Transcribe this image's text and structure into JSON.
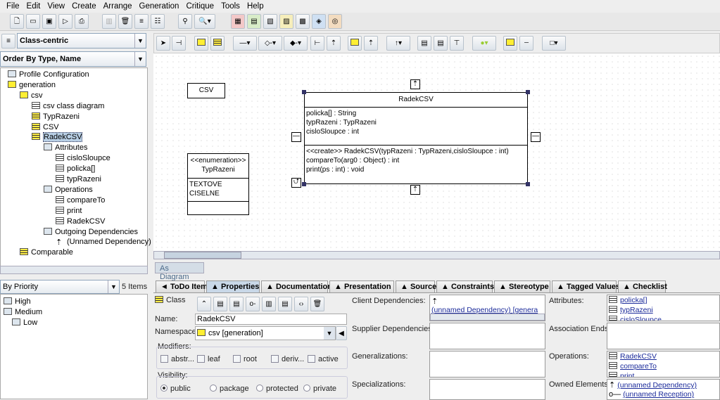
{
  "menu": [
    "File",
    "Edit",
    "View",
    "Create",
    "Arrange",
    "Generation",
    "Critique",
    "Tools",
    "Help"
  ],
  "explorer": {
    "perspective": "Class-centric",
    "order": "Order By Type, Name",
    "tree": [
      {
        "label": "Profile Configuration",
        "level": 0,
        "icon": "folder-icon"
      },
      {
        "label": "generation",
        "level": 0,
        "icon": "package-icon"
      },
      {
        "label": "csv",
        "level": 1,
        "icon": "package-icon"
      },
      {
        "label": "csv class diagram",
        "level": 2,
        "icon": "class-diagram-icon"
      },
      {
        "label": "TypRazeni",
        "level": 2,
        "icon": "enumeration-icon"
      },
      {
        "label": "CSV",
        "level": 2,
        "icon": "class-icon"
      },
      {
        "label": "RadekCSV",
        "level": 2,
        "icon": "class-icon",
        "selected": true
      },
      {
        "label": "Attributes",
        "level": 3,
        "icon": "folder-icon"
      },
      {
        "label": "cisloSloupce",
        "level": 4,
        "icon": "attribute-icon"
      },
      {
        "label": "policka[]",
        "level": 4,
        "icon": "attribute-icon"
      },
      {
        "label": "typRazeni",
        "level": 4,
        "icon": "attribute-icon"
      },
      {
        "label": "Operations",
        "level": 3,
        "icon": "folder-icon"
      },
      {
        "label": "compareTo",
        "level": 4,
        "icon": "operation-icon"
      },
      {
        "label": "print",
        "level": 4,
        "icon": "operation-icon"
      },
      {
        "label": "RadekCSV",
        "level": 4,
        "icon": "operation-icon"
      },
      {
        "label": "Outgoing Dependencies",
        "level": 3,
        "icon": "folder-icon"
      },
      {
        "label": "(Unnamed Dependency)",
        "level": 4,
        "icon": "dependency-icon"
      },
      {
        "label": "Comparable",
        "level": 1,
        "icon": "interface-icon"
      }
    ]
  },
  "todo": {
    "sort": "By Priority",
    "count": "5 Items",
    "items": [
      "High",
      "Medium",
      "Low"
    ]
  },
  "diagram": {
    "tab": "As Diagram",
    "csv_class": "CSV",
    "enum": {
      "stereotype": "<<enumeration>>",
      "name": "TypRazeni",
      "literals": [
        "TEXTOVE",
        "CISELNE"
      ]
    },
    "radek": {
      "name": "RadekCSV",
      "attributes": [
        "policka[] : String",
        "typRazeni : TypRazeni",
        "cisloSloupce : int"
      ],
      "operations": [
        "<<create>> RadekCSV(typRazeni : TypRazeni,cisloSloupce : int)",
        "compareTo(arg0 : Object) : int",
        "print(ps : int) : void"
      ]
    }
  },
  "details": {
    "tabs": [
      "◄ ToDo Item",
      "▲ Properties",
      "▲ Documentation",
      "▲ Presentation",
      "▲ Source",
      "▲ Constraints",
      "▲ Stereotype",
      "▲ Tagged Values",
      "▲ Checklist"
    ],
    "type": "Class",
    "name_label": "Name:",
    "name": "RadekCSV",
    "namespace_label": "Namespace:",
    "namespace": "csv [generation]",
    "modifiers_label": "Modifiers:",
    "modifiers": [
      "abstr...",
      "leaf",
      "root",
      "deriv...",
      "active"
    ],
    "visibility_label": "Visibility:",
    "visibility": [
      "public",
      "package",
      "protected",
      "private"
    ],
    "visibility_selected": "public",
    "client_deps_label": "Client Dependencies:",
    "client_deps": "(unnamed Dependency) [genera",
    "supplier_deps_label": "Supplier Dependencies:",
    "generalizations_label": "Generalizations:",
    "specializations_label": "Specializations:",
    "attributes_label": "Attributes:",
    "attributes": [
      "policka[]",
      "typRazeni",
      "cisloSloupce"
    ],
    "assoc_label": "Association Ends:",
    "operations_label": "Operations:",
    "operations": [
      "RadekCSV",
      "compareTo",
      "print"
    ],
    "owned_label": "Owned Elements:",
    "owned": [
      "(unnamed Dependency)",
      "(unnamed Reception)"
    ]
  }
}
